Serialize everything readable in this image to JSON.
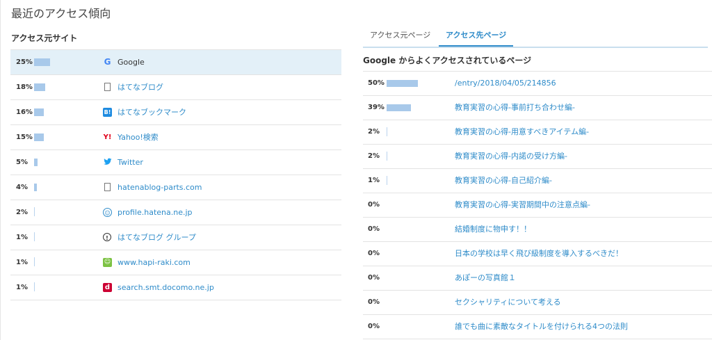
{
  "page_title": "最近のアクセス傾向",
  "sources": {
    "title": "アクセス元サイト",
    "items": [
      {
        "pct": "25%",
        "value": 25,
        "label": "Google",
        "icon": "google-icon"
      },
      {
        "pct": "18%",
        "value": 18,
        "label": "はてなブログ",
        "icon": "document-icon"
      },
      {
        "pct": "16%",
        "value": 16,
        "label": "はてなブックマーク",
        "icon": "hatena-bookmark-icon"
      },
      {
        "pct": "15%",
        "value": 15,
        "label": "Yahoo!検索",
        "icon": "yahoo-icon"
      },
      {
        "pct": "5%",
        "value": 5,
        "label": "Twitter",
        "icon": "twitter-icon"
      },
      {
        "pct": "4%",
        "value": 4,
        "label": "hatenablog-parts.com",
        "icon": "document-icon"
      },
      {
        "pct": "2%",
        "value": 2,
        "label": "profile.hatena.ne.jp",
        "icon": "profile-icon"
      },
      {
        "pct": "1%",
        "value": 1,
        "label": "はてなブログ グループ",
        "icon": "group-icon"
      },
      {
        "pct": "1%",
        "value": 1,
        "label": "www.hapi-raki.com",
        "icon": "hapi-raki-icon"
      },
      {
        "pct": "1%",
        "value": 1,
        "label": "search.smt.docomo.ne.jp",
        "icon": "docomo-icon"
      }
    ]
  },
  "tabs": [
    {
      "label": "アクセス元ページ",
      "active": false
    },
    {
      "label": "アクセス先ページ",
      "active": true
    }
  ],
  "pages": {
    "title": "Google からよくアクセスされているページ",
    "items": [
      {
        "pct": "50%",
        "value": 50,
        "label": "/entry/2018/04/05/214856"
      },
      {
        "pct": "39%",
        "value": 39,
        "label": "教育実習の心得-事前打ち合わせ編-"
      },
      {
        "pct": "2%",
        "value": 2,
        "label": "教育実習の心得-用意すべきアイテム編-"
      },
      {
        "pct": "2%",
        "value": 2,
        "label": "教育実習の心得-内諾の受け方編-"
      },
      {
        "pct": "1%",
        "value": 1,
        "label": "教育実習の心得-自己紹介編-"
      },
      {
        "pct": "0%",
        "value": 0,
        "label": "教育実習の心得-実習期間中の注意点編-"
      },
      {
        "pct": "0%",
        "value": 0,
        "label": "結婚制度に物申す！！"
      },
      {
        "pct": "0%",
        "value": 0,
        "label": "日本の学校は早く飛び級制度を導入するべきだ！"
      },
      {
        "pct": "0%",
        "value": 0,
        "label": "あぽーの写真館１"
      },
      {
        "pct": "0%",
        "value": 0,
        "label": "セクシャリティについて考える"
      },
      {
        "pct": "0%",
        "value": 0,
        "label": "誰でも曲に素敵なタイトルを付けられる4つの法則"
      }
    ]
  },
  "colors": {
    "link": "#2e8bc9",
    "bar": "#a8c9ea",
    "selected_row": "#e3f0f8"
  }
}
